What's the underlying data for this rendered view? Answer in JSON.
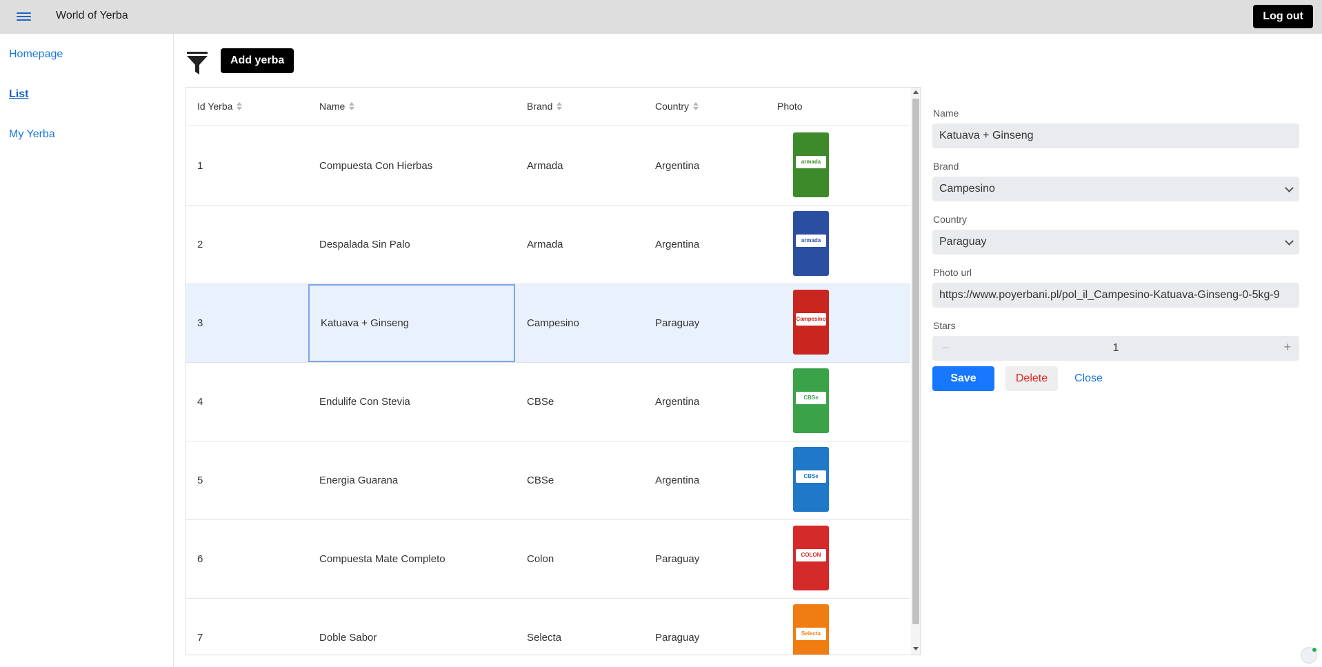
{
  "app": {
    "title": "World of Yerba",
    "logout_label": "Log out"
  },
  "sidebar": {
    "items": [
      {
        "label": "Homepage"
      },
      {
        "label": "List",
        "active": true
      },
      {
        "label": "My Yerba"
      }
    ]
  },
  "toolbar": {
    "add_label": "Add yerba",
    "filter_icon": "filter-icon"
  },
  "table": {
    "columns": [
      {
        "label": "Id Yerba",
        "sortable": true
      },
      {
        "label": "Name",
        "sortable": true
      },
      {
        "label": "Brand",
        "sortable": true
      },
      {
        "label": "Country",
        "sortable": true
      },
      {
        "label": "Photo",
        "sortable": false
      }
    ],
    "rows": [
      {
        "id": "1",
        "name": "Compuesta Con Hierbas",
        "brand": "Armada",
        "country": "Argentina",
        "photo_color": "#3d8a2a",
        "label": "armada"
      },
      {
        "id": "2",
        "name": "Despalada Sin Palo",
        "brand": "Armada",
        "country": "Argentina",
        "photo_color": "#2b4fa0",
        "label": "armada"
      },
      {
        "id": "3",
        "name": "Katuava + Ginseng",
        "brand": "Campesino",
        "country": "Paraguay",
        "photo_color": "#c9261f",
        "label": "Campesino",
        "selected": true
      },
      {
        "id": "4",
        "name": "Endulife Con Stevia",
        "brand": "CBSe",
        "country": "Argentina",
        "photo_color": "#3aa34a",
        "label": "CBSe"
      },
      {
        "id": "5",
        "name": "Energia Guarana",
        "brand": "CBSe",
        "country": "Argentina",
        "photo_color": "#1f78c8",
        "label": "CBSe"
      },
      {
        "id": "6",
        "name": "Compuesta Mate Completo",
        "brand": "Colon",
        "country": "Paraguay",
        "photo_color": "#d42a2a",
        "label": "COLON"
      },
      {
        "id": "7",
        "name": "Doble Sabor",
        "brand": "Selecta",
        "country": "Paraguay",
        "photo_color": "#f07d12",
        "label": "Selecta"
      }
    ]
  },
  "form": {
    "name_label": "Name",
    "name_value": "Katuava + Ginseng",
    "brand_label": "Brand",
    "brand_value": "Campesino",
    "country_label": "Country",
    "country_value": "Paraguay",
    "photo_label": "Photo url",
    "photo_value": "https://www.poyerbani.pl/pol_il_Campesino-Katuava-Ginseng-0-5kg-9",
    "stars_label": "Stars",
    "stars_value": "1",
    "save_label": "Save",
    "delete_label": "Delete",
    "close_label": "Close"
  },
  "colors": {
    "accent": "#1677ff",
    "selected_row": "#e8f1fc",
    "topbar": "#dedede",
    "danger": "#e02424"
  }
}
